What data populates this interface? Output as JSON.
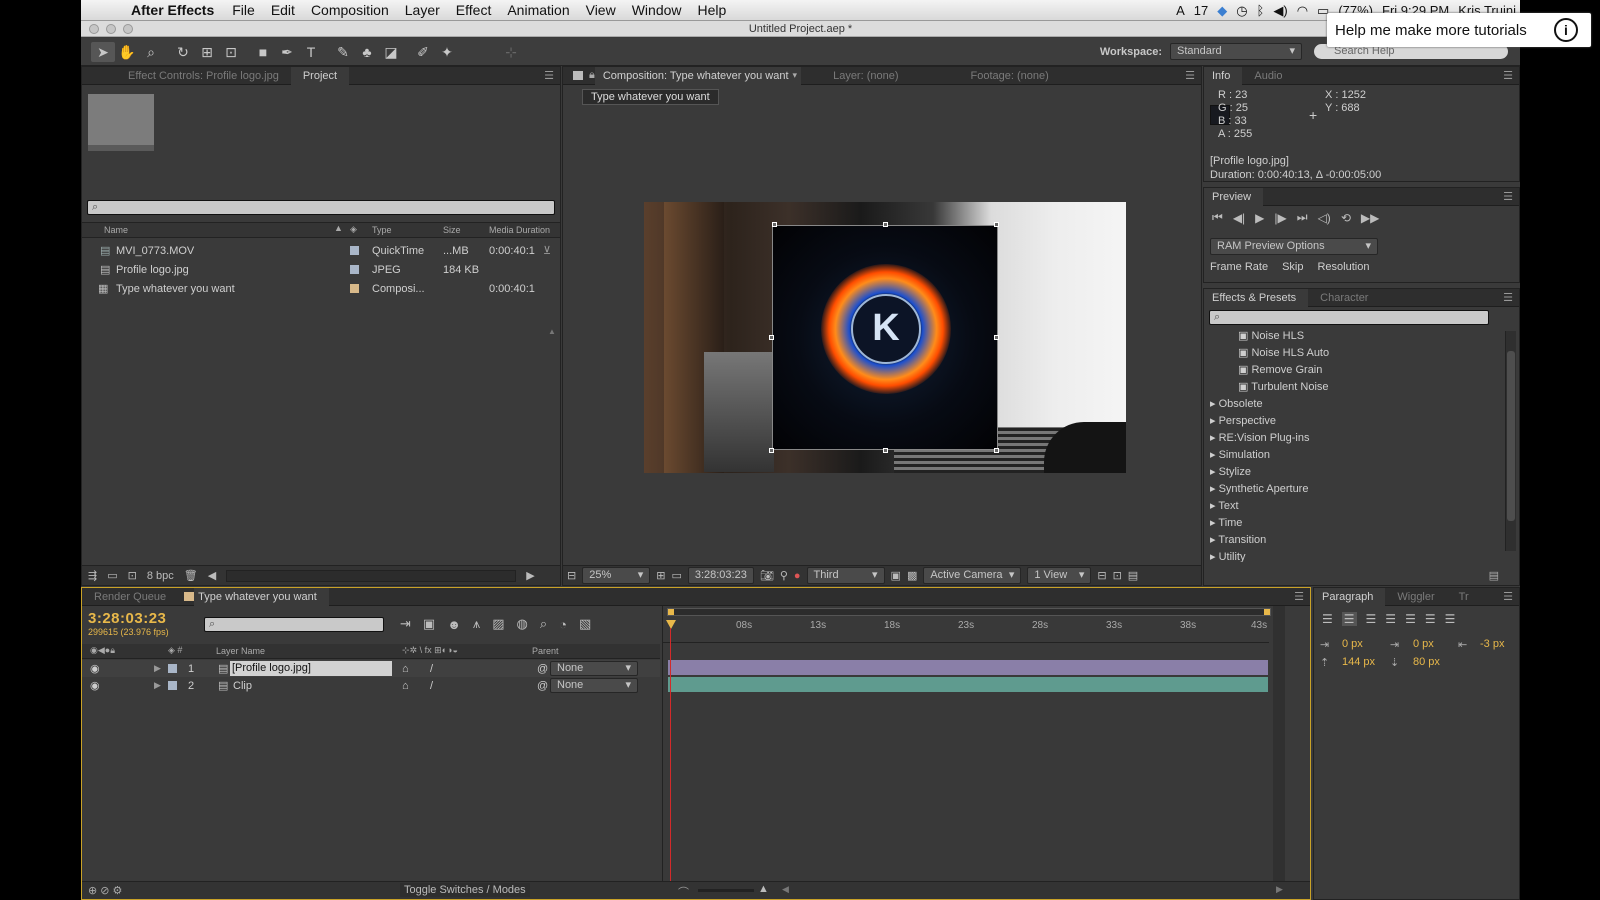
{
  "menubar": {
    "app": "After Effects",
    "items": [
      "File",
      "Edit",
      "Composition",
      "Layer",
      "Effect",
      "Animation",
      "View",
      "Window",
      "Help"
    ],
    "status": {
      "adobe_count": "17",
      "battery": "(77%)",
      "clock": "Fri 9:29 PM",
      "user": "Kris Truini"
    }
  },
  "window": {
    "title": "Untitled Project.aep *"
  },
  "workspace": {
    "label": "Workspace:",
    "value": "Standard",
    "search_placeholder": "Search Help"
  },
  "tooltip": {
    "text": "Help me make more tutorials",
    "icon": "info-icon"
  },
  "project_panel": {
    "tabs": [
      "Effect Controls: Profile logo.jpg",
      "Project"
    ],
    "columns": [
      "Name",
      "Type",
      "Size",
      "Media Duration"
    ],
    "items": [
      {
        "name": "MVI_0773.MOV",
        "type": "QuickTime",
        "size": "...MB",
        "duration": "0:00:40:1",
        "label_color": "#a9b6c8"
      },
      {
        "name": "Profile logo.jpg",
        "type": "JPEG",
        "size": "184 KB",
        "duration": "",
        "label_color": "#a9b6c8"
      },
      {
        "name": "Type whatever you want",
        "type": "Composi...",
        "size": "",
        "duration": "0:00:40:1",
        "label_color": "#d8b98a"
      }
    ],
    "bpc": "8 bpc"
  },
  "comp_panel": {
    "tabs": [
      "Composition: Type whatever you want",
      "Layer: (none)",
      "Footage: (none)"
    ],
    "comp_label": "Type whatever you want",
    "zoom": "25%",
    "timecode": "3:28:03:23",
    "resolution": "Third",
    "camera": "Active Camera",
    "views": "1 View",
    "logo_letter": "K"
  },
  "info_panel": {
    "tabs": [
      "Info",
      "Audio"
    ],
    "r": "R : 23",
    "g": "G : 25",
    "b": "B : 33",
    "a": "A : 255",
    "x": "X : 1252",
    "y": "Y : 688",
    "file": "[Profile logo.jpg]",
    "duration": "Duration: 0:00:40:13, Δ -0:00:05:00"
  },
  "preview_panel": {
    "title": "Preview",
    "ram_option": "RAM Preview Options",
    "frame_rate": "Frame Rate",
    "skip": "Skip",
    "resolution": "Resolution"
  },
  "effects_panel": {
    "tabs": [
      "Effects & Presets",
      "Character"
    ],
    "effects": [
      "Noise HLS",
      "Noise HLS Auto",
      "Remove Grain",
      "Turbulent Noise"
    ],
    "categories": [
      "Obsolete",
      "Perspective",
      "RE:Vision Plug-ins",
      "Simulation",
      "Stylize",
      "Synthetic Aperture",
      "Text",
      "Time",
      "Transition",
      "Utility"
    ]
  },
  "timeline": {
    "tabs": [
      "Render Queue",
      "Type whatever you want"
    ],
    "timecode": "3:28:03:23",
    "frames": "299615 (23.976 fps)",
    "col_layer": "Layer Name",
    "col_parent": "Parent",
    "layers": [
      {
        "num": "1",
        "name": "[Profile logo.jpg]",
        "parent": "None",
        "color": "#a9b6c8",
        "bar": "#8a7fa8"
      },
      {
        "num": "2",
        "name": "Clip",
        "parent": "None",
        "color": "#a9b6c8",
        "bar": "#5f9b8f"
      }
    ],
    "ticks": [
      "08s",
      "13s",
      "18s",
      "23s",
      "28s",
      "33s",
      "38s",
      "43s"
    ],
    "toggle": "Toggle Switches / Modes"
  },
  "paragraph_panel": {
    "tabs": [
      "Paragraph",
      "Wiggler",
      "Tr"
    ],
    "indent_left": "0 px",
    "indent_first": "0 px",
    "indent_right": "-3 px",
    "space_before": "144 px",
    "space_after": "80 px"
  }
}
